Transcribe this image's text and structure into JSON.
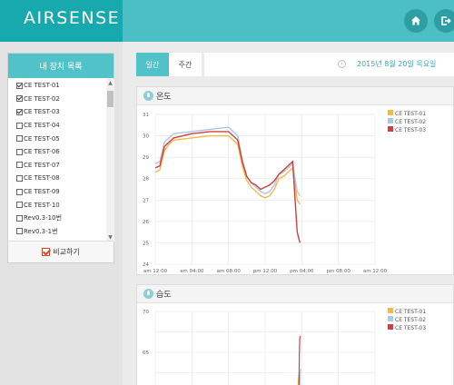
{
  "app": {
    "logo": "AIRSENSE"
  },
  "topbar": {
    "home_icon": "home-icon",
    "logout_icon": "logout-icon"
  },
  "sidebar": {
    "title": "내 장치 목록",
    "devices": [
      {
        "label": "CE TEST-01",
        "checked": true
      },
      {
        "label": "CE TEST-02",
        "checked": true
      },
      {
        "label": "CE TEST-03",
        "checked": true
      },
      {
        "label": "CE TEST-04",
        "checked": false
      },
      {
        "label": "CE TEST-05",
        "checked": false
      },
      {
        "label": "CE TEST-06",
        "checked": false
      },
      {
        "label": "CE TEST-07",
        "checked": false
      },
      {
        "label": "CE TEST-08",
        "checked": false
      },
      {
        "label": "CE TEST-09",
        "checked": false
      },
      {
        "label": "CE TEST-10",
        "checked": false
      },
      {
        "label": "Rev0.3-10번",
        "checked": false
      },
      {
        "label": "Rev0.3-1번",
        "checked": false
      }
    ],
    "compare_label": "비교하기",
    "compare_checked": true
  },
  "tabs": [
    {
      "label": "일간",
      "active": true
    },
    {
      "label": "주간",
      "active": false
    }
  ],
  "date_label": "2015년 8월 20일 목요일",
  "colors": {
    "accent": "#51c2c8",
    "s1": "#f5b94a",
    "s2": "#a9c8ea",
    "s3": "#cf3f3f"
  },
  "charts": {
    "temperature": {
      "title": "온도"
    },
    "humidity": {
      "title": "습도"
    }
  },
  "chart_data": [
    {
      "type": "line",
      "title": "온도",
      "ylim": [
        24,
        31
      ],
      "yticks": [
        "24",
        "25",
        "26",
        "27",
        "28",
        "29",
        "30",
        "31"
      ],
      "xlim": [
        0,
        24
      ],
      "xticks": [
        "am 12:00",
        "am 04:00",
        "am 08:00",
        "pm 12:00",
        "pm 04:00",
        "pm 08:00",
        "am 12:00"
      ],
      "legend": "top-right",
      "series": [
        {
          "name": "CE TEST-01",
          "color": "#f5b94a",
          "x": [
            0,
            0.5,
            1,
            1.5,
            2,
            4,
            6,
            8,
            9,
            9.5,
            10,
            10.5,
            11,
            11.5,
            12,
            12.5,
            13,
            13.5,
            14,
            14.5,
            15,
            15.5,
            15.8
          ],
          "y": [
            28.3,
            28.4,
            29.3,
            29.6,
            29.8,
            29.9,
            30.0,
            30.0,
            29.6,
            28.6,
            27.9,
            27.6,
            27.4,
            27.2,
            27.1,
            27.2,
            27.5,
            28.0,
            28.1,
            28.3,
            28.5,
            27.0,
            26.8
          ]
        },
        {
          "name": "CE TEST-02",
          "color": "#a9c8ea",
          "x": [
            0,
            0.5,
            1,
            1.5,
            2,
            4,
            6,
            8,
            9,
            9.5,
            10,
            10.5,
            11,
            11.5,
            12,
            12.5,
            13,
            13.5,
            14,
            14.5,
            15,
            15.5,
            15.8
          ],
          "y": [
            28.7,
            28.8,
            29.7,
            29.9,
            30.1,
            30.2,
            30.3,
            30.4,
            30.0,
            28.9,
            28.1,
            27.8,
            27.6,
            27.4,
            27.3,
            27.4,
            27.7,
            28.2,
            28.3,
            28.5,
            28.7,
            27.4,
            27.2
          ]
        },
        {
          "name": "CE TEST-03",
          "color": "#cf3f3f",
          "x": [
            0,
            0.5,
            1,
            1.5,
            2,
            4,
            6,
            8,
            9,
            9.5,
            10,
            10.5,
            11,
            11.5,
            12,
            12.5,
            13,
            13.5,
            14,
            14.5,
            15,
            15.5,
            15.8
          ],
          "y": [
            28.5,
            28.6,
            29.5,
            29.7,
            29.9,
            30.1,
            30.2,
            30.2,
            29.8,
            28.8,
            28.1,
            27.8,
            27.7,
            27.5,
            27.6,
            27.7,
            27.9,
            28.2,
            28.4,
            28.6,
            28.8,
            25.5,
            25.0
          ]
        }
      ]
    },
    {
      "type": "line",
      "title": "습도",
      "ylim": [
        50,
        70
      ],
      "yticks": [
        "65",
        "70"
      ],
      "legend": "top-right",
      "series": [
        {
          "name": "CE TEST-01",
          "color": "#f5b94a"
        },
        {
          "name": "CE TEST-02",
          "color": "#a9c8ea"
        },
        {
          "name": "CE TEST-03",
          "color": "#cf3f3f"
        }
      ]
    }
  ]
}
